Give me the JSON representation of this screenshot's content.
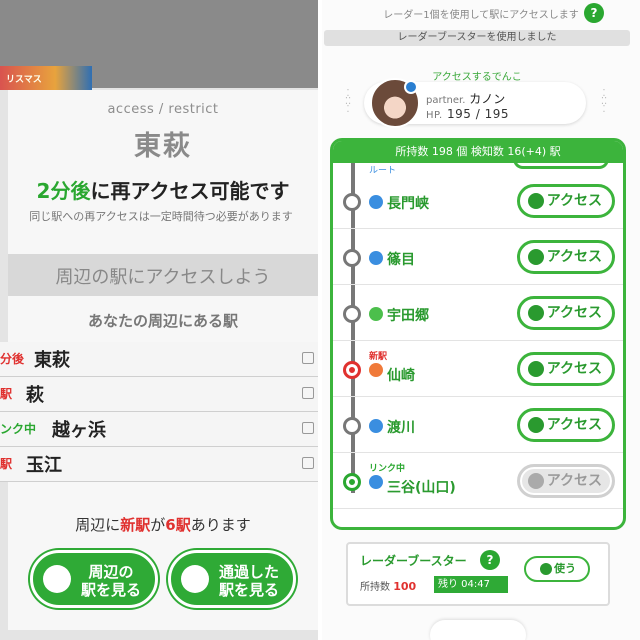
{
  "left": {
    "banner_text": "リスマス",
    "header_sub": "access / restrict",
    "header_title": "東萩",
    "notice_highlight": "2分後",
    "notice_rest": "に再アクセス可能です",
    "notice_small": "同じ駅への再アクセスは一定時間待つ必要があります",
    "gray_label": "周辺の駅にアクセスしよう",
    "nearby_title": "あなたの周辺にある駅",
    "stations": [
      {
        "prefix": "分後",
        "prefix_color": "#e0312f",
        "name": "東萩"
      },
      {
        "prefix": "駅",
        "prefix_color": "#e0312f",
        "name": "萩"
      },
      {
        "prefix": "ンク中",
        "prefix_color": "#2aa730",
        "name": "越ヶ浜"
      },
      {
        "prefix": "駅",
        "prefix_color": "#e0312f",
        "name": "玉江"
      }
    ],
    "new_line_pre": "周辺に",
    "new_line_new": "新駅",
    "new_line_mid": "が",
    "new_line_count": "6駅",
    "new_line_post": "あります",
    "btn_nearby_l1": "周辺の",
    "btn_nearby_l2": "駅を見る",
    "btn_passed_l1": "通過した",
    "btn_passed_l2": "駅を見る"
  },
  "right": {
    "top_text": "レーダー1個を使用して駅にアクセスします",
    "help_glyph": "?",
    "boost_bar": "レーダーブースターを使用しました",
    "access_denko": "アクセスするでんこ",
    "partner_label": "partner.",
    "partner_name": "カノン",
    "hp_label": "HP.",
    "hp_value": "195 / 195",
    "list_head": "所持数 198 個 検知数 16(+4) 駅",
    "route_label": "ルート",
    "stations": [
      {
        "name": "長門峡",
        "tag": "",
        "tag_color": "",
        "attr_color": "#3a8ee0",
        "node": "#777",
        "button": "アクセス",
        "enabled": true
      },
      {
        "name": "篠目",
        "tag": "",
        "tag_color": "",
        "attr_color": "#3a8ee0",
        "node": "#777",
        "button": "アクセス",
        "enabled": true
      },
      {
        "name": "宇田郷",
        "tag": "",
        "tag_color": "",
        "attr_color": "#4cbf4c",
        "node": "#777",
        "button": "アクセス",
        "enabled": true
      },
      {
        "name": "仙崎",
        "tag": "新駅",
        "tag_color": "#e0312f",
        "attr_color": "#f07a3a",
        "node": "#e0312f",
        "button": "アクセス",
        "enabled": true
      },
      {
        "name": "渡川",
        "tag": "",
        "tag_color": "",
        "attr_color": "#3a8ee0",
        "node": "#777",
        "button": "アクセス",
        "enabled": true
      },
      {
        "name": "三谷(山口)",
        "tag": "リンク中",
        "tag_color": "#2aa730",
        "attr_color": "#3a8ee0",
        "node": "#2aa730",
        "button": "アクセス",
        "enabled": false
      }
    ],
    "booster_title": "レーダーブースター",
    "booster_count_label": "所持数",
    "booster_count": "100",
    "booster_remain": "残り 04:47",
    "use_label": "使う"
  },
  "colors": {
    "green": "#2aa730",
    "red": "#e0312f",
    "gray": "#8a8a8a"
  }
}
